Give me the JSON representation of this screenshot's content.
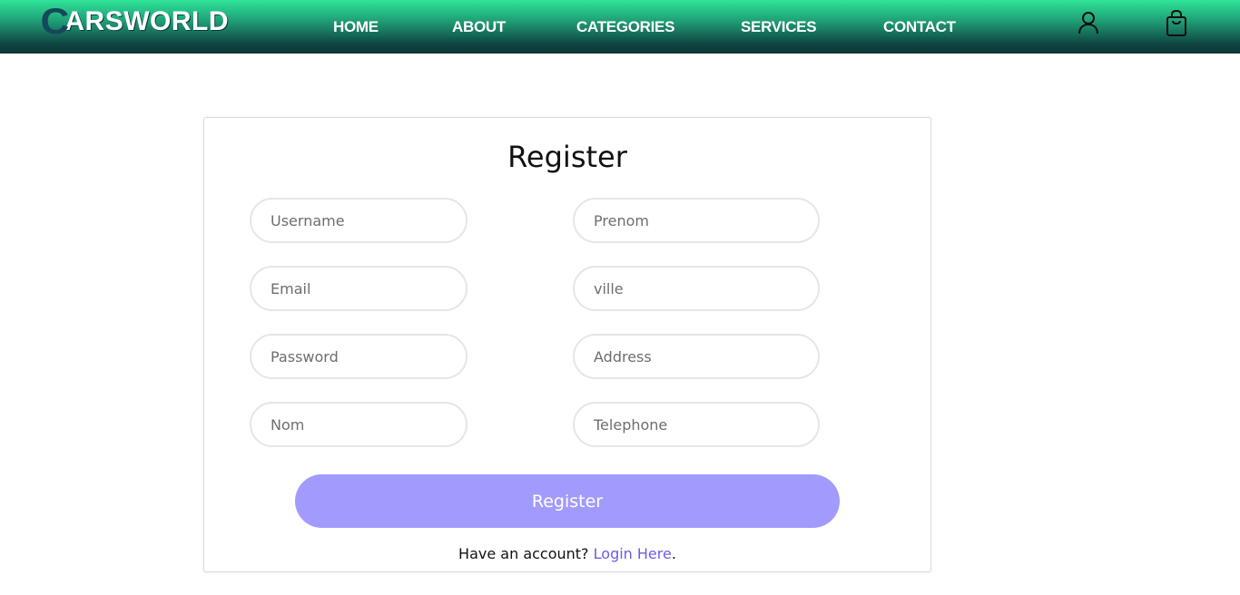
{
  "header": {
    "logo_first": "C",
    "logo_rest": "ARSWORLD",
    "nav": [
      {
        "label": "HOME"
      },
      {
        "label": "ABOUT"
      },
      {
        "label": "CATEGORIES"
      },
      {
        "label": "SERVICES"
      },
      {
        "label": "CONTACT"
      }
    ],
    "icons": [
      "user-icon",
      "shopping-bag-icon"
    ]
  },
  "form": {
    "title": "Register",
    "fields": {
      "username": {
        "placeholder": "Username",
        "value": ""
      },
      "email": {
        "placeholder": "Email",
        "value": ""
      },
      "password": {
        "placeholder": "Password",
        "value": ""
      },
      "nom": {
        "placeholder": "Nom",
        "value": ""
      },
      "prenom": {
        "placeholder": "Prenom",
        "value": ""
      },
      "ville": {
        "placeholder": "ville",
        "value": ""
      },
      "address": {
        "placeholder": "Address",
        "value": ""
      },
      "telephone": {
        "placeholder": "Telephone",
        "value": ""
      }
    },
    "submit_label": "Register",
    "login_prompt": "Have an account? ",
    "login_link": "Login Here",
    "login_suffix": "."
  },
  "colors": {
    "nav_gradient_top": "#2fe59a",
    "nav_gradient_bottom": "#0a3536",
    "logo_accent": "#16475a",
    "button": "#a29bfe",
    "link": "#6c5ce7"
  }
}
